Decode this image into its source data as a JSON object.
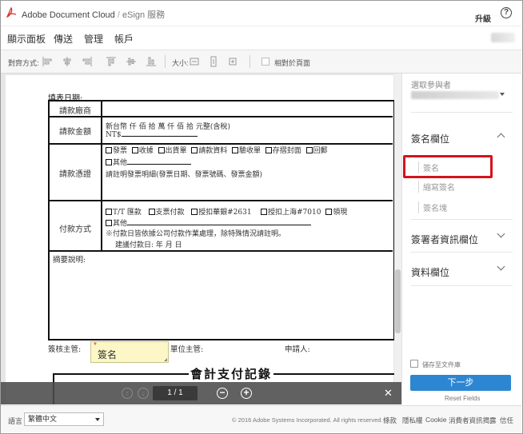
{
  "header": {
    "app_name": "Adobe Document Cloud",
    "separator": "/",
    "service": "eSign 服務",
    "upgrade_label": "升級",
    "help_label": "?"
  },
  "nav": {
    "items": [
      {
        "label": "顯示面板"
      },
      {
        "label": "傳送"
      },
      {
        "label": "管理"
      },
      {
        "label": "帳戶"
      }
    ]
  },
  "toolbar": {
    "align_label": "對齊方式:",
    "size_label": "大小:",
    "relative_label": "相對於頁面"
  },
  "document": {
    "fill_date_label": "填表日期:",
    "rows": [
      {
        "label": "請款廠商"
      },
      {
        "label": "請款金額",
        "line1": "新台幣    仟    佰    拾    萬    仟    佰    拾    元整(含稅)",
        "line2": "NT$"
      },
      {
        "label": "請款憑證",
        "options": [
          "發票",
          "收據",
          "出貨單",
          "請款資料",
          "驗收單",
          "存摺封面",
          "回郵"
        ],
        "other": "其他",
        "note": "請註明發票明細(發票日期、發票號碼、發票金額)"
      },
      {
        "label": "付款方式",
        "options": [
          "T/T 匯款",
          "支票付款",
          "授扣華銀#2631",
          "授扣上海#7010",
          "領現"
        ],
        "other": "其他",
        "note": "※付款日皆依據公司付款作業處理，除特殊情況請註明。",
        "date": "建議付款日:      年      月      日"
      },
      {
        "label": "摘要說明:"
      }
    ],
    "approver_label": "簽核主管:",
    "unit_label": "單位主管:",
    "applicant_label": "申請人:",
    "sig_field_label": "簽名",
    "required_mark": "*",
    "second_title": "會計支付記錄"
  },
  "page_controls": {
    "page_indicator": "1 / 1",
    "zoom_out": "−",
    "zoom_in": "+",
    "close": "✕"
  },
  "right_panel": {
    "recipient_title": "選取參與者",
    "sections": [
      {
        "title": "簽名欄位",
        "expanded": true,
        "items": [
          "簽名",
          "縮寫簽名",
          "簽名塊"
        ]
      },
      {
        "title": "簽署者資訊欄位",
        "expanded": false
      },
      {
        "title": "資料欄位",
        "expanded": false
      }
    ],
    "save_to_library": "儲存至文件庫",
    "next_button": "下一步",
    "reset_fields": "Reset Fields"
  },
  "footer": {
    "language_label": "語言",
    "language_value": "繁體中文",
    "copyright": "© 2016 Adobe Systems Incorporated. All rights reserved.",
    "links": [
      "條款",
      "隱私權",
      "Cookie",
      "消費者資訊揭露",
      "信任"
    ]
  },
  "colors": {
    "primary_button": "#2d86d2",
    "highlight_box": "#d4141b",
    "signature_field": "#fdf7c7"
  }
}
